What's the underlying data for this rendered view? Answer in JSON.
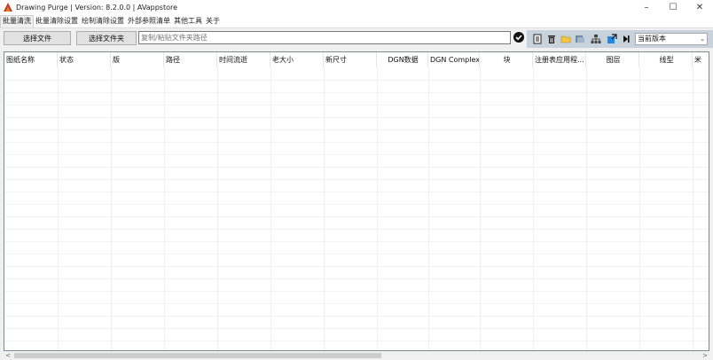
{
  "window": {
    "title": "Drawing Purge  | Version: 8.2.0.0 |  AVappstore",
    "minimize": "–",
    "maximize": "☐",
    "close": "✕"
  },
  "menu": {
    "tabs": [
      "批量清洗",
      "批量清除设置",
      "绘制清除设置",
      "外部参照清单",
      "其他工具",
      "关于"
    ]
  },
  "toolbar": {
    "select_file": "选择文件",
    "select_folder": "选择文件夹",
    "path_placeholder": "复制/粘贴文件夹路径",
    "version_select": "当前版本",
    "version_arrow": "⌄",
    "icons": [
      "check-icon",
      "document-icon",
      "delete-icon",
      "folder-icon",
      "export-icon",
      "network-icon",
      "open-external-icon",
      "play-icon"
    ]
  },
  "table": {
    "columns": [
      "图纸名称",
      "状态",
      "版",
      "路径",
      "时间流逝",
      "老大小",
      "新尺寸",
      "DGN数据",
      "DGN Complex...",
      "块",
      "注册表应用程...",
      "图层",
      "线型",
      "米"
    ]
  },
  "scrollbar": {
    "left_arrow": "<",
    "right_arrow": ">"
  },
  "colors": {
    "accent": "#c7d2dc",
    "title_icon": "#c0392b"
  }
}
